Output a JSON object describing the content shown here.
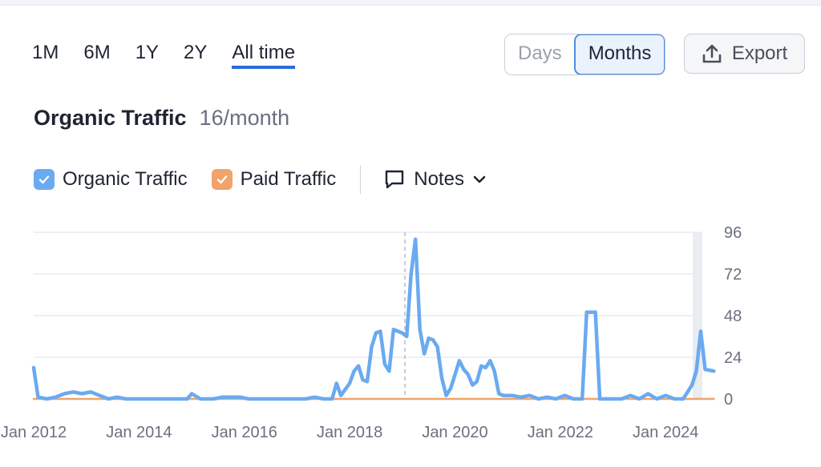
{
  "ranges": [
    "1M",
    "6M",
    "1Y",
    "2Y",
    "All time"
  ],
  "active_range": "All time",
  "view_toggle": {
    "days": "Days",
    "months": "Months",
    "active": "Months"
  },
  "export_label": "Export",
  "header": {
    "title": "Organic Traffic",
    "subtitle": "16/month"
  },
  "legend": {
    "organic": "Organic Traffic",
    "paid": "Paid Traffic",
    "notes": "Notes"
  },
  "colors": {
    "organic": "#6aaaf0",
    "paid": "#f0a36a",
    "accent": "#2d6bd6"
  },
  "icons": {
    "export": "export-icon",
    "notes": "notes-icon",
    "chevron": "chevron-down-icon",
    "check": "check-icon"
  },
  "chart_data": {
    "type": "line",
    "x_tick_labels": [
      "Jan 2012",
      "Jan 2014",
      "Jan 2016",
      "Jan 2018",
      "Jan 2020",
      "Jan 2022",
      "Jan 2024"
    ],
    "y_ticks": [
      0,
      24,
      48,
      72,
      96
    ],
    "ylim": [
      0,
      96
    ],
    "xlim": [
      "2012-01",
      "2024-09"
    ],
    "grid": true,
    "series": [
      {
        "name": "Organic Traffic",
        "points": [
          [
            "2012-01",
            18
          ],
          [
            "2012-02",
            1
          ],
          [
            "2012-04",
            0
          ],
          [
            "2012-06",
            1
          ],
          [
            "2012-08",
            3
          ],
          [
            "2012-10",
            4
          ],
          [
            "2012-12",
            3
          ],
          [
            "2013-02",
            4
          ],
          [
            "2013-04",
            2
          ],
          [
            "2013-06",
            0
          ],
          [
            "2013-08",
            1
          ],
          [
            "2013-10",
            0
          ],
          [
            "2014-01",
            0
          ],
          [
            "2014-06",
            0
          ],
          [
            "2014-12",
            0
          ],
          [
            "2015-01",
            3
          ],
          [
            "2015-03",
            0
          ],
          [
            "2015-06",
            0
          ],
          [
            "2015-08",
            1
          ],
          [
            "2015-12",
            1
          ],
          [
            "2016-02",
            0
          ],
          [
            "2016-06",
            0
          ],
          [
            "2016-10",
            0
          ],
          [
            "2017-01",
            0
          ],
          [
            "2017-03",
            0
          ],
          [
            "2017-05",
            1
          ],
          [
            "2017-07",
            0
          ],
          [
            "2017-09",
            0
          ],
          [
            "2017-10",
            9
          ],
          [
            "2017-11",
            2
          ],
          [
            "2018-01",
            9
          ],
          [
            "2018-02",
            16
          ],
          [
            "2018-03",
            19
          ],
          [
            "2018-04",
            11
          ],
          [
            "2018-05",
            10
          ],
          [
            "2018-06",
            30
          ],
          [
            "2018-07",
            38
          ],
          [
            "2018-08",
            39
          ],
          [
            "2018-09",
            20
          ],
          [
            "2018-10",
            16
          ],
          [
            "2018-11",
            40
          ],
          [
            "2018-12",
            39
          ],
          [
            "2019-01",
            38
          ],
          [
            "2019-02",
            36
          ],
          [
            "2019-03",
            72
          ],
          [
            "2019-04",
            92
          ],
          [
            "2019-05",
            40
          ],
          [
            "2019-06",
            26
          ],
          [
            "2019-07",
            35
          ],
          [
            "2019-08",
            34
          ],
          [
            "2019-09",
            30
          ],
          [
            "2019-10",
            12
          ],
          [
            "2019-11",
            2
          ],
          [
            "2019-12",
            6
          ],
          [
            "2020-01",
            14
          ],
          [
            "2020-02",
            22
          ],
          [
            "2020-03",
            17
          ],
          [
            "2020-04",
            14
          ],
          [
            "2020-05",
            8
          ],
          [
            "2020-06",
            10
          ],
          [
            "2020-07",
            19
          ],
          [
            "2020-08",
            18
          ],
          [
            "2020-09",
            22
          ],
          [
            "2020-10",
            16
          ],
          [
            "2020-11",
            3
          ],
          [
            "2020-12",
            2
          ],
          [
            "2021-02",
            2
          ],
          [
            "2021-04",
            1
          ],
          [
            "2021-06",
            2
          ],
          [
            "2021-08",
            0
          ],
          [
            "2021-10",
            1
          ],
          [
            "2021-12",
            0
          ],
          [
            "2022-02",
            2
          ],
          [
            "2022-04",
            0
          ],
          [
            "2022-06",
            0
          ],
          [
            "2022-07",
            50
          ],
          [
            "2022-09",
            50
          ],
          [
            "2022-10",
            0
          ],
          [
            "2022-12",
            0
          ],
          [
            "2023-03",
            0
          ],
          [
            "2023-05",
            2
          ],
          [
            "2023-07",
            0
          ],
          [
            "2023-09",
            3
          ],
          [
            "2023-11",
            0
          ],
          [
            "2024-01",
            2
          ],
          [
            "2024-03",
            0
          ],
          [
            "2024-05",
            0
          ],
          [
            "2024-06",
            4
          ],
          [
            "2024-07",
            8
          ],
          [
            "2024-08",
            16
          ],
          [
            "2024-09",
            39
          ],
          [
            "2024-10",
            17
          ],
          [
            "2024-12",
            16
          ]
        ]
      },
      {
        "name": "Paid Traffic",
        "points": [
          [
            "2012-01",
            0
          ],
          [
            "2024-12",
            0
          ]
        ]
      }
    ]
  }
}
